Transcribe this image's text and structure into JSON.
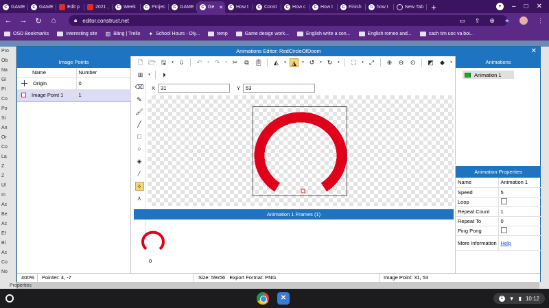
{
  "browser": {
    "tabs": [
      {
        "icon": "construct-icon",
        "label": "GAME",
        "active": false
      },
      {
        "icon": "construct-icon",
        "label": "GAME",
        "active": false
      },
      {
        "icon": "slides-icon",
        "label": "Edit p",
        "active": false
      },
      {
        "icon": "slides-icon",
        "label": "2021 ,",
        "active": false
      },
      {
        "icon": "construct-icon",
        "label": "Week",
        "active": false
      },
      {
        "icon": "construct-icon",
        "label": "Projec",
        "active": false
      },
      {
        "icon": "construct-icon",
        "label": "GAME",
        "active": false
      },
      {
        "icon": "construct-icon",
        "label": "Ge",
        "active": true
      },
      {
        "icon": "construct-icon",
        "label": "How t",
        "active": false
      },
      {
        "icon": "construct-icon",
        "label": "Const",
        "active": false
      },
      {
        "icon": "construct-icon",
        "label": "How c",
        "active": false
      },
      {
        "icon": "construct-icon",
        "label": "How t",
        "active": false
      },
      {
        "icon": "construct-icon",
        "label": "Finish",
        "active": false
      },
      {
        "icon": "google-icon",
        "label": "how t",
        "active": false
      },
      {
        "icon": "newtab-icon",
        "label": "New Tab",
        "active": false
      }
    ],
    "url": "editor.construct.net",
    "bookmarks": [
      {
        "type": "folder",
        "label": "OSD Bookmarks"
      },
      {
        "type": "folder",
        "label": "Interesting site"
      },
      {
        "type": "trello",
        "label": "Bảng | Trello"
      },
      {
        "type": "school",
        "label": "School Hours - Oly..."
      },
      {
        "type": "folder",
        "label": "temp"
      },
      {
        "type": "folder",
        "label": "Game design work..."
      },
      {
        "type": "folder",
        "label": "English write a son..."
      },
      {
        "type": "folder",
        "label": "English romeo and..."
      },
      {
        "type": "folder",
        "label": "cach tim uoc va boi..."
      }
    ]
  },
  "background": {
    "left_items": [
      "Pro",
      "Ob",
      "Na",
      "Gl",
      "Pl",
      "Co",
      "Po",
      "Si",
      "An",
      "Or",
      "Co",
      "La",
      "Z",
      "Z",
      "Ul",
      "In",
      "Ac",
      "Be",
      "Ac",
      "Ef",
      "Bl",
      "Ac",
      "Co",
      "No",
      "Properties"
    ]
  },
  "dialog": {
    "title": "Animations Editor: RedCircleOfDoom",
    "image_points": {
      "header": "Image Points",
      "columns": [
        "Name",
        "Number"
      ],
      "rows": [
        {
          "icon": "origin-crosshair-icon",
          "name": "Origin",
          "number": "0",
          "selected": false
        },
        {
          "icon": "image-point-square-icon",
          "name": "Image Point 1",
          "number": "1",
          "selected": true
        }
      ]
    },
    "coords": {
      "x_label": "X",
      "x_value": "31",
      "y_label": "Y",
      "y_value": "53"
    },
    "frames": {
      "header": "Animation 1 Frames (1)",
      "items": [
        {
          "label": "0"
        }
      ]
    },
    "animations": {
      "header": "Animations",
      "items": [
        {
          "label": "Animation 1"
        }
      ]
    },
    "properties": {
      "header": "Animation Properties",
      "rows": [
        {
          "label": "Name",
          "value": "Animation 1",
          "kind": "text"
        },
        {
          "label": "Speed",
          "value": "5",
          "kind": "text"
        },
        {
          "label": "Loop",
          "value": "",
          "kind": "checkbox"
        },
        {
          "label": "Repeat Count",
          "value": "1",
          "kind": "text"
        },
        {
          "label": "Repeat To",
          "value": "0",
          "kind": "text"
        },
        {
          "label": "Ping Pong",
          "value": "",
          "kind": "checkbox"
        },
        {
          "label": "More Information",
          "value": "Help",
          "kind": "link"
        }
      ]
    },
    "status": {
      "zoom": "400%",
      "pointer": "Pointer: 4, -7",
      "size": "Size: 59x56",
      "export": "Export Format: PNG",
      "image_point": "Image Point: 31, 53"
    }
  },
  "shelf": {
    "time": "10:12",
    "notifications": "1"
  },
  "colors": {
    "accent": "#1f74c1",
    "sprite": "#e0001a",
    "browser": "#5b2a86"
  }
}
